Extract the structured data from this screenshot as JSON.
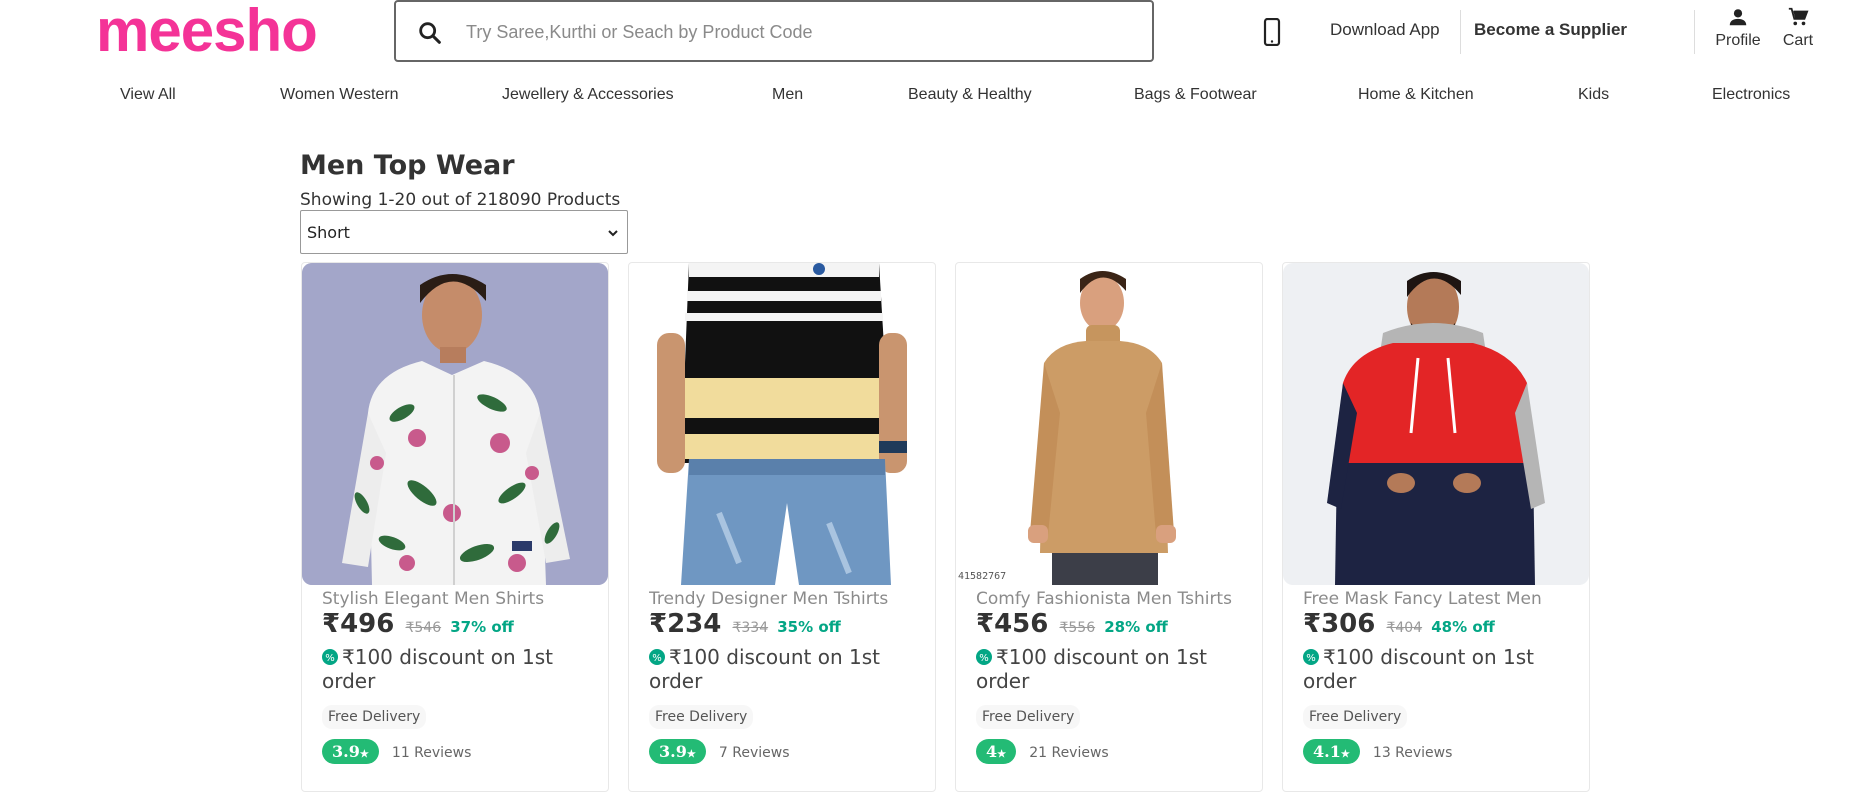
{
  "header": {
    "logo": "meesho",
    "search_placeholder": "Try Saree,Kurthi or Seach by Product Code",
    "download_app": "Download App",
    "become_supplier": "Become a Supplier",
    "profile": "Profile",
    "cart": "Cart"
  },
  "nav": {
    "items": [
      "View All",
      "Women Western",
      "Jewellery & Accessories",
      "Men",
      "Beauty & Healthy",
      "Bags & Footwear",
      "Home & Kitchen",
      "Kids",
      "Electronics"
    ]
  },
  "listing": {
    "title": "Men Top Wear",
    "showing": "Showing 1-20 out of 218090 Products",
    "sort_selected": "Short"
  },
  "products": [
    {
      "name": "Stylish Elegant Men Shirts",
      "price": "₹496",
      "mrp": "₹546",
      "off": "37% off",
      "discount": "₹100 discount on 1st order",
      "delivery": "Free Delivery",
      "rating": "3.9",
      "reviews": "11 Reviews",
      "image": "floral-white-shirt"
    },
    {
      "name": "Trendy Designer Men Tshirts",
      "price": "₹234",
      "mrp": "₹334",
      "off": "35% off",
      "discount": "₹100 discount on 1st order",
      "delivery": "Free Delivery",
      "rating": "3.9",
      "reviews": "7 Reviews",
      "image": "striped-polo-tshirt"
    },
    {
      "name": "Comfy Fashionista Men Tshirts",
      "price": "₹456",
      "mrp": "₹556",
      "off": "28% off",
      "discount": "₹100 discount on 1st order",
      "delivery": "Free Delivery",
      "rating": "4",
      "reviews": "21 Reviews",
      "image": "tan-turtleneck",
      "code": "41582767"
    },
    {
      "name": "Free Mask Fancy Latest Men",
      "price": "₹306",
      "mrp": "₹404",
      "off": "48% off",
      "discount": "₹100 discount on 1st order",
      "delivery": "Free Delivery",
      "rating": "4.1",
      "reviews": "13 Reviews",
      "image": "red-navy-hoodie"
    }
  ],
  "colors": {
    "brand": "#f43397",
    "discount_green": "#03a685",
    "rating_green": "#23bb75"
  }
}
